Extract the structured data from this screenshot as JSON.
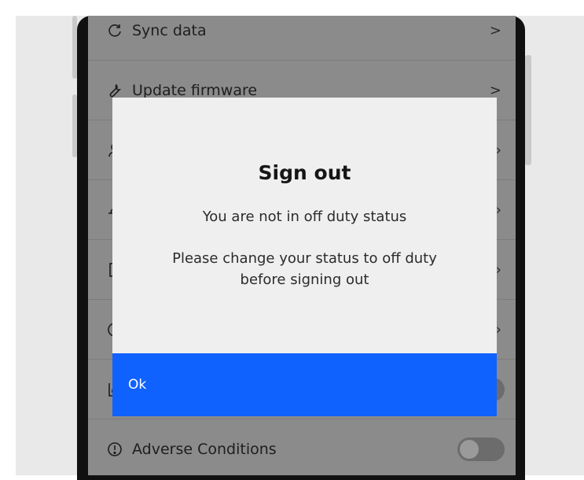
{
  "menu": {
    "sync_label": "Sync data",
    "firmware_label": "Update firmware",
    "adverse_label": "Adverse Conditions",
    "chevron": ">"
  },
  "dialog": {
    "title": "Sign out",
    "message_status": "You are not in off duty status",
    "message_instruction": "Please change your status to off duty before signing out",
    "ok_label": "Ok"
  },
  "colors": {
    "primary_button": "#0f62fe",
    "overlay_bg": "#8b8b8b",
    "dialog_bg": "#efefef"
  },
  "icons": [
    "sync-icon",
    "wrench-icon",
    "user-icon",
    "hat-icon",
    "document-icon",
    "clock-icon",
    "chart-icon",
    "info-icon",
    "chevron-right-icon"
  ],
  "adverse_toggle": {
    "on": false
  }
}
